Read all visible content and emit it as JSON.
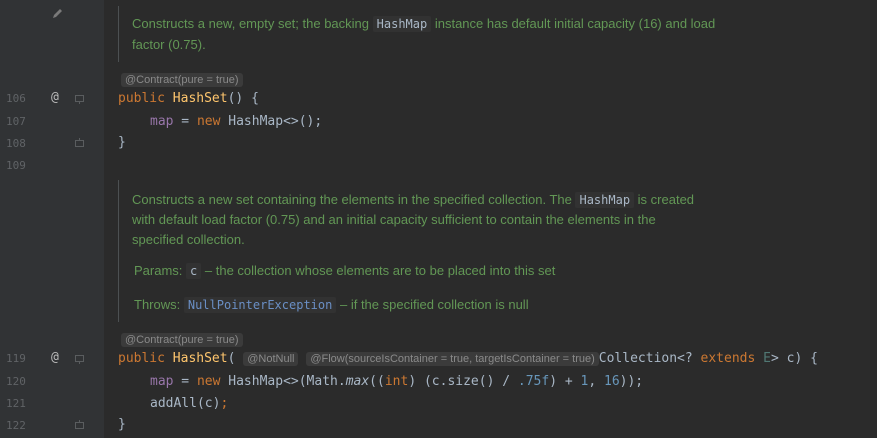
{
  "doc1": {
    "line1_a": "Constructs a new, empty set; the backing",
    "line1_code": "HashMap",
    "line1_b": "instance has default initial capacity (16) and load",
    "line2": "factor (0.75)."
  },
  "annotation1": "@Contract(pure = true)",
  "code1": {
    "l106": {
      "num": "106",
      "kw": "public",
      "name": "HashSet",
      "rest": "() {"
    },
    "l107": {
      "num": "107",
      "field": "map",
      "eq": " = ",
      "kw": "new",
      "cls": " HashMap<>();"
    },
    "l108": {
      "num": "108",
      "brace": "}"
    },
    "l109": {
      "num": "109"
    }
  },
  "doc2": {
    "line1_a": "Constructs a new set containing the elements in the specified collection. The",
    "line1_code": "HashMap",
    "line1_b": "is created",
    "line2": "with default load factor (0.75) and an initial capacity sufficient to contain the elements in the",
    "line3": "specified collection.",
    "params_label": "Params:",
    "params_code": "c",
    "params_text": "– the collection whose elements are to be placed into this set",
    "throws_label": "Throws:",
    "throws_code": "NullPointerException",
    "throws_text": "– if the specified collection is null"
  },
  "annotation2": "@Contract(pure = true)",
  "code2": {
    "l119": {
      "num": "119",
      "kw": "public",
      "name": "HashSet",
      "paren": "(",
      "hint1": "@NotNull",
      "hint2": "@Flow(sourceIsContainer = true, targetIsContainer = true)",
      "type": "Collection<? ",
      "ext": "extends",
      "tp": " E",
      "rest": "> c) {"
    },
    "l120": {
      "num": "120",
      "field": "map",
      "eq": " = ",
      "kw": "new",
      "p1": " HashMap<>(Math.",
      "max": "max",
      "p2": "((",
      "int": "int",
      "p3": ") (c.size() / ",
      "n1": ".75f",
      "p4": ") + ",
      "n2": "1",
      "p5": ", ",
      "n3": "16",
      "p6": "));"
    },
    "l121": {
      "num": "121",
      "text": "addAll(c)",
      "semi": ";"
    },
    "l122": {
      "num": "122",
      "brace": "}"
    }
  },
  "icons": {
    "edit": "pencil-icon",
    "override": "at-sign-icon",
    "fold": "fold-marker-icon"
  },
  "colors": {
    "background": "#2b2b2b",
    "gutter": "#313335",
    "doc_text": "#629755",
    "keyword": "#cc7832",
    "method": "#ffc66d",
    "field": "#9876aa",
    "number": "#6897bb"
  }
}
